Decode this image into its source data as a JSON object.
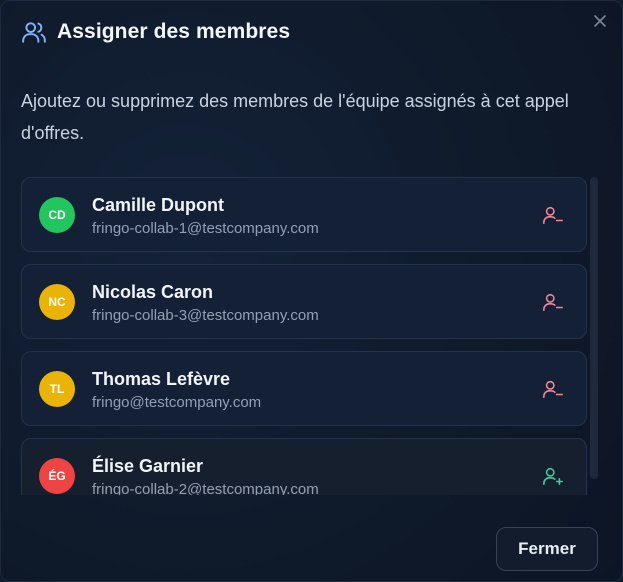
{
  "dialog": {
    "title": "Assigner des membres",
    "title_icon": "users-icon",
    "description": "Ajoutez ou supprimez des membres de l'équipe assignés à cet appel d'offres.",
    "close_icon": "close-icon"
  },
  "members": [
    {
      "initials": "CD",
      "name": "Camille Dupont",
      "email": "fringo-collab-1@testcompany.com",
      "avatar_color": "#22c55e",
      "assigned": true,
      "action_icon": "user-minus-icon"
    },
    {
      "initials": "NC",
      "name": "Nicolas Caron",
      "email": "fringo-collab-3@testcompany.com",
      "avatar_color": "#eab308",
      "assigned": true,
      "action_icon": "user-minus-icon"
    },
    {
      "initials": "TL",
      "name": "Thomas Lefèvre",
      "email": "fringo@testcompany.com",
      "avatar_color": "#eab308",
      "assigned": true,
      "action_icon": "user-minus-icon"
    },
    {
      "initials": "ÉG",
      "name": "Élise Garnier",
      "email": "fringo-collab-2@testcompany.com",
      "avatar_color": "#ef4444",
      "assigned": false,
      "action_icon": "user-plus-icon"
    }
  ],
  "footer": {
    "close_label": "Fermer"
  },
  "colors": {
    "remove_action": "#f08a9a",
    "add_action": "#34d399",
    "title_icon": "#7fb2ff"
  }
}
